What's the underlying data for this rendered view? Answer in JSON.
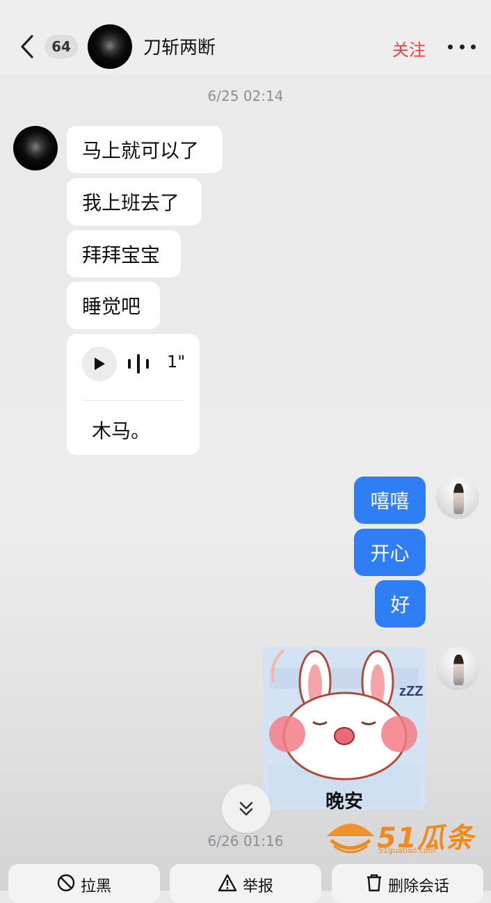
{
  "header": {
    "unread_count": "64",
    "contact_name": "刀斩两断",
    "follow_label": "关注"
  },
  "messages": {
    "time_1": "6/25 02:14",
    "incoming": [
      "马上就可以了",
      "我上班去了",
      "拜拜宝宝",
      "睡觉吧"
    ],
    "voice": {
      "duration": "1\"",
      "transcript": "木马。"
    },
    "outgoing": [
      "嘻嘻",
      "开心",
      "好"
    ],
    "sticker_caption": "晚安",
    "time_2": "6/26 01:16"
  },
  "watermark": {
    "text": "51瓜条",
    "url": "51guatiao.com"
  },
  "actions": {
    "block": "拉黑",
    "report": "举报",
    "delete": "删除会话"
  },
  "colors": {
    "accent_blue": "#2f7ef5",
    "follow_red": "#e8404a",
    "watermark_orange": "#f08a1c"
  },
  "icons": [
    "chevron-left-icon",
    "more-icon",
    "play-icon",
    "voice-wave-icon",
    "double-chevron-down-icon",
    "block-icon",
    "warning-icon",
    "trash-icon"
  ]
}
